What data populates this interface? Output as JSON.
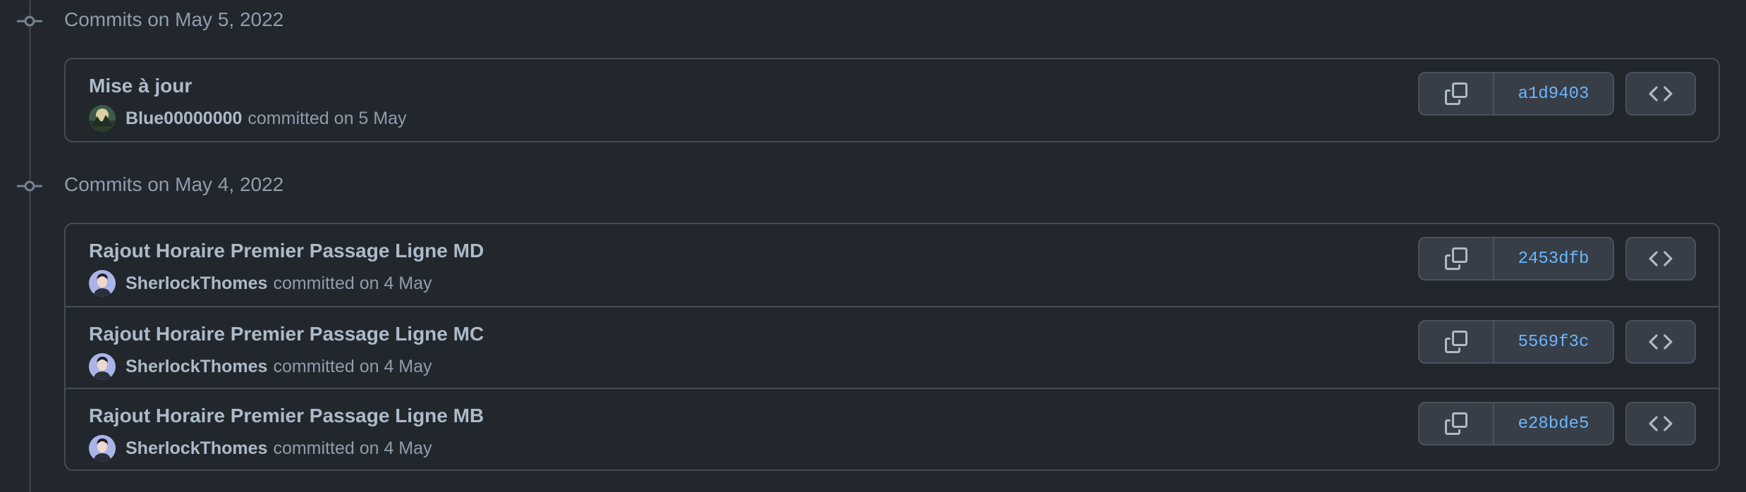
{
  "groups": [
    {
      "title": "Commits on May 5, 2022",
      "commits": [
        {
          "title": "Mise à jour",
          "author": "Blue00000000",
          "committed": "committed on 5 May",
          "sha": "a1d9403",
          "avatar_icon": "landscape-avatar-icon"
        }
      ]
    },
    {
      "title": "Commits on May 4, 2022",
      "commits": [
        {
          "title": "Rajout Horaire Premier Passage Ligne MD",
          "author": "SherlockThomes",
          "committed": "committed on 4 May",
          "sha": "2453dfb",
          "avatar_icon": "person-avatar-icon"
        },
        {
          "title": "Rajout Horaire Premier Passage Ligne MC",
          "author": "SherlockThomes",
          "committed": "committed on 4 May",
          "sha": "5569f3c",
          "avatar_icon": "person-avatar-icon"
        },
        {
          "title": "Rajout Horaire Premier Passage Ligne MB",
          "author": "SherlockThomes",
          "committed": "committed on 4 May",
          "sha": "e28bde5",
          "avatar_icon": "person-avatar-icon"
        }
      ]
    }
  ],
  "icons": {
    "commit_node": "git-commit-icon",
    "copy": "copy-icon",
    "browse": "code-icon"
  },
  "colors": {
    "background": "#22272e",
    "border": "#444c56",
    "button_bg": "#373e47",
    "sha_link": "#6cb6ff",
    "text_primary": "#adbac7",
    "text_muted": "#909dab"
  }
}
